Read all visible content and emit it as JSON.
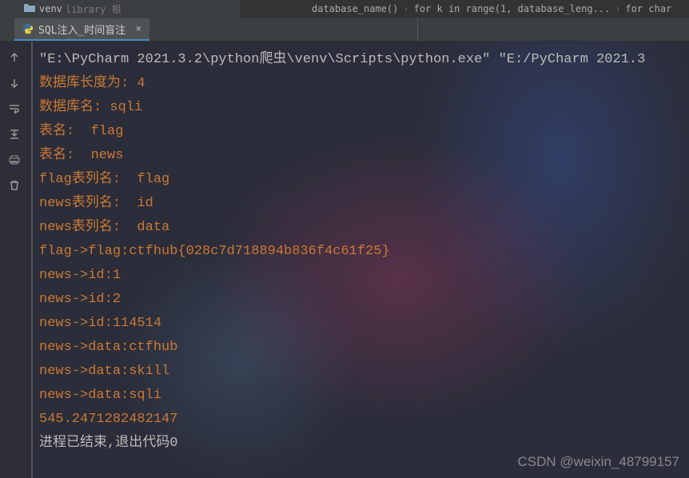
{
  "project": {
    "folder_name": "venv",
    "lib_suffix": "library 根"
  },
  "breadcrumb": {
    "items": [
      "database_name()",
      "for k in range(1, database_leng...",
      "for char"
    ]
  },
  "tab": {
    "label": "SQL注入_时间盲注",
    "close": "×"
  },
  "console": {
    "lines": [
      {
        "cls": "cmd",
        "text": "\"E:\\PyCharm 2021.3.2\\python爬虫\\venv\\Scripts\\python.exe\" \"E:/PyCharm 2021.3"
      },
      {
        "cls": "orange",
        "text": "数据库长度为: 4"
      },
      {
        "cls": "orange",
        "text": "数据库名: sqli"
      },
      {
        "cls": "orange",
        "text": "表名:  flag"
      },
      {
        "cls": "orange",
        "text": "表名:  news"
      },
      {
        "cls": "orange",
        "text": "flag表列名:  flag"
      },
      {
        "cls": "orange",
        "text": "news表列名:  id"
      },
      {
        "cls": "orange",
        "text": "news表列名:  data"
      },
      {
        "cls": "orange",
        "text": "flag->flag:ctfhub{028c7d718894b836f4c61f25}"
      },
      {
        "cls": "orange",
        "text": "news->id:1"
      },
      {
        "cls": "orange",
        "text": "news->id:2"
      },
      {
        "cls": "orange",
        "text": "news->id:114514"
      },
      {
        "cls": "orange",
        "text": "news->data:ctfhub"
      },
      {
        "cls": "orange",
        "text": "news->data:skill"
      },
      {
        "cls": "orange",
        "text": "news->data:sqli"
      },
      {
        "cls": "orange",
        "text": "545.2471282482147"
      },
      {
        "cls": "cmd",
        "text": ""
      },
      {
        "cls": "cmd",
        "text": "进程已结束,退出代码0"
      }
    ]
  },
  "watermark": "CSDN @weixin_48799157"
}
